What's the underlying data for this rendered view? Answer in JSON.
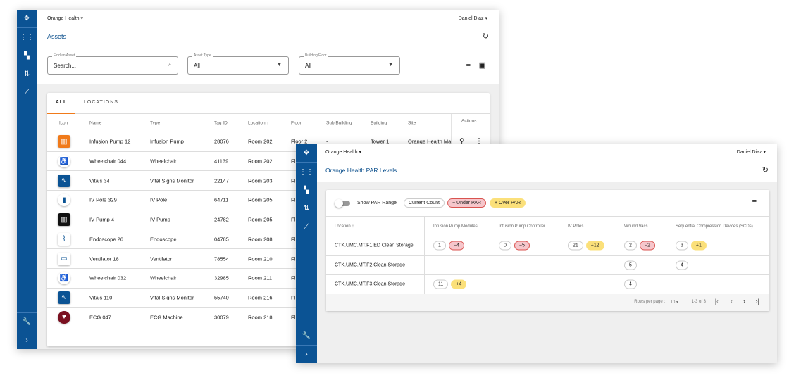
{
  "assets_window": {
    "org": "Orange Health",
    "user": "Daniel Diaz",
    "title": "Assets",
    "filters": [
      {
        "label": "Find an Asset",
        "value": "Search..."
      },
      {
        "label": "Asset Type",
        "value": "All"
      },
      {
        "label": "Building/Floor",
        "value": "All"
      }
    ],
    "tabs": [
      "ALL",
      "LOCATIONS"
    ],
    "columns": [
      "Icon",
      "Name",
      "Type",
      "Tag ID",
      "Location ↑",
      "Floor",
      "Sub Building",
      "Building",
      "Site",
      "Actions"
    ],
    "rows": [
      {
        "icon": "infusion-pump",
        "name": "Infusion Pump 12",
        "type": "Infusion Pump",
        "tag": "28076",
        "location": "Room 202",
        "floor": "Floor 2",
        "sub": "-",
        "building": "Tower 1",
        "site": "Orange Health Ma"
      },
      {
        "icon": "wheelchair",
        "name": "Wheelchair 044",
        "type": "Wheelchair",
        "tag": "41139",
        "location": "Room 202",
        "floor": "Fl"
      },
      {
        "icon": "vitals-monitor",
        "name": "Vitals 34",
        "type": "Vital Signs Monitor",
        "tag": "22147",
        "location": "Room 203",
        "floor": "Fl"
      },
      {
        "icon": "iv-pole",
        "name": "IV Pole 329",
        "type": "IV Pole",
        "tag": "64711",
        "location": "Room 205",
        "floor": "Fl"
      },
      {
        "icon": "iv-pump",
        "name": "IV Pump 4",
        "type": "IV Pump",
        "tag": "24782",
        "location": "Room 205",
        "floor": "Fl"
      },
      {
        "icon": "endoscope",
        "name": "Endoscope 26",
        "type": "Endoscope",
        "tag": "04785",
        "location": "Room 208",
        "floor": "Fl"
      },
      {
        "icon": "ventilator",
        "name": "Ventilator 18",
        "type": "Ventilator",
        "tag": "78554",
        "location": "Room 210",
        "floor": "Fl"
      },
      {
        "icon": "wheelchair",
        "name": "Wheelchair 032",
        "type": "Wheelchair",
        "tag": "32985",
        "location": "Room 211",
        "floor": "Fl"
      },
      {
        "icon": "vitals-monitor",
        "name": "Vitals 110",
        "type": "Vital Signs Monitor",
        "tag": "55740",
        "location": "Room 216",
        "floor": "Fl"
      },
      {
        "icon": "ecg-heart",
        "name": "ECG 047",
        "type": "ECG Machine",
        "tag": "30079",
        "location": "Room 218",
        "floor": "Fl"
      }
    ]
  },
  "par_window": {
    "org": "Orange Health",
    "user": "Daniel Diaz",
    "title": "Orange Health PAR Levels",
    "toggle_label": "Show PAR Range",
    "toggle_on": false,
    "legend": {
      "current": "Current Count",
      "under": "− Under PAR",
      "over": "+ Over PAR"
    },
    "columns": [
      "Location ↑",
      "Infusion Pump Modules",
      "Infusion Pump Controller",
      "IV Poles",
      "Wound Vacs",
      "Sequential Compression Devices (SCDs)"
    ],
    "rows": [
      {
        "location": "CTK.UMC.MT.F1.ED Clean Storage",
        "cells": [
          {
            "count": "1",
            "delta": "−4",
            "kind": "under"
          },
          {
            "count": "0",
            "delta": "−5",
            "kind": "under"
          },
          {
            "count": "21",
            "delta": "+12",
            "kind": "over"
          },
          {
            "count": "2",
            "delta": "−2",
            "kind": "under"
          },
          {
            "count": "3",
            "delta": "+1",
            "kind": "over"
          }
        ]
      },
      {
        "location": "CTK.UMC.MT.F2.Clean Storage",
        "cells": [
          {
            "count": "-"
          },
          {
            "count": "-"
          },
          {
            "count": "-"
          },
          {
            "count": "5",
            "pill": true
          },
          {
            "count": "4",
            "pill": true
          }
        ]
      },
      {
        "location": "CTK.UMC.MT.F3.Clean Storage",
        "cells": [
          {
            "count": "11",
            "delta": "+4",
            "kind": "over"
          },
          {
            "count": "-"
          },
          {
            "count": "-"
          },
          {
            "count": "4",
            "pill": true
          },
          {
            "count": "-"
          }
        ]
      }
    ],
    "footer": {
      "rows_per_page_label": "Rows per page :",
      "rows_per_page": "10",
      "range": "1-3 of 3"
    }
  },
  "colors": {
    "sidebar": "#0b5394",
    "accent": "#f07a1a",
    "under": "#f6c6cb",
    "over": "#fbe07a"
  }
}
